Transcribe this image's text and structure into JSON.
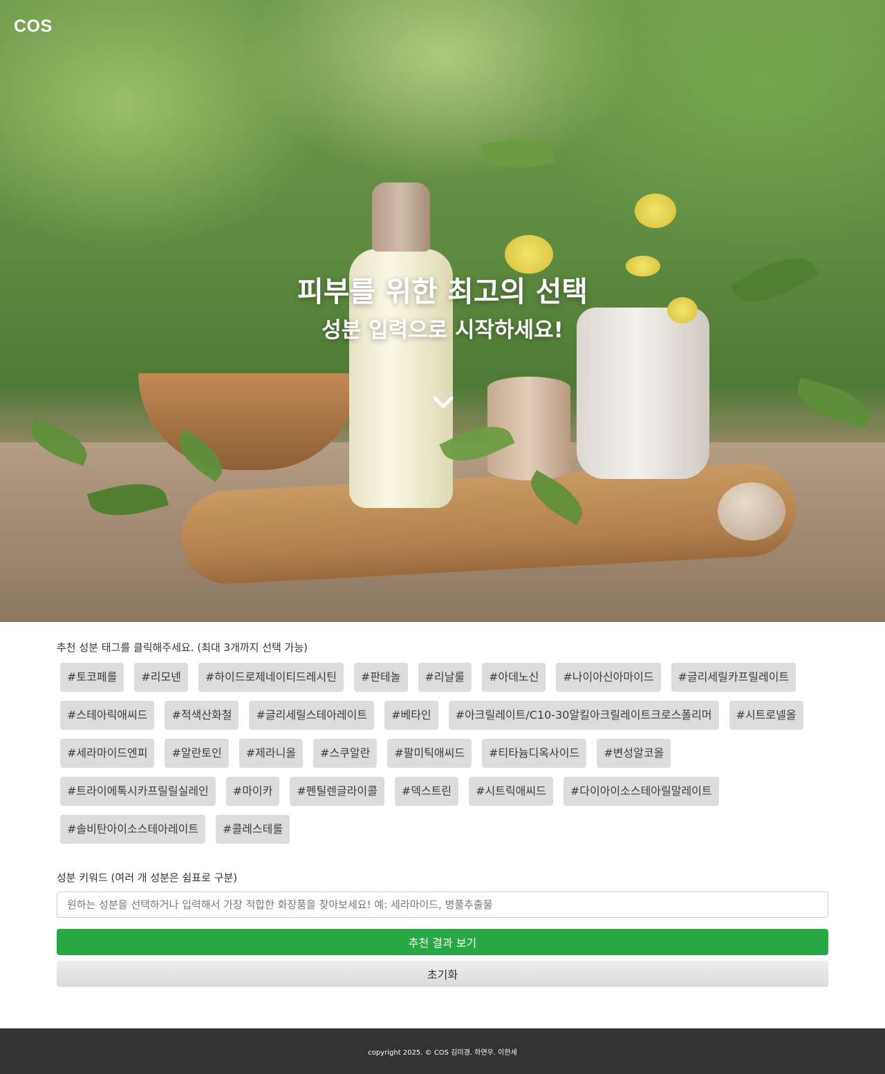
{
  "header": {
    "logo": "COS"
  },
  "hero": {
    "title": "피부를 위한 최고의 선택",
    "subtitle": "성분 입력으로 시작하세요!",
    "scroll_icon": "chevron-down-icon"
  },
  "tags_section": {
    "label": "추천 성분 태그를 클릭해주세요. (최대 3개까지 선택 가능)",
    "tags": [
      "#토코페롤",
      "#리모넨",
      "#하이드로제네이티드레시틴",
      "#판테놀",
      "#리날룰",
      "#아데노신",
      "#나이아신아마이드",
      "#글리세릴카프릴레이트",
      "#스테아릭애씨드",
      "#적색산화철",
      "#글리세릴스테아레이트",
      "#베타인",
      "#아크릴레이트/C10-30알킬아크릴레이트크로스폴리머",
      "#시트로넬올",
      "#세라마이드엔피",
      "#알란토인",
      "#제라니올",
      "#스쿠알란",
      "#팔미틱애씨드",
      "#티타늄디옥사이드",
      "#변성알코올",
      "#트라이에톡시카프릴릴실레인",
      "#마이카",
      "#펜틸렌글라이콜",
      "#덱스트린",
      "#시트릭애씨드",
      "#다이아이소스테아릴말레이트",
      "#솔비탄아이소스테아레이트",
      "#콜레스테롤"
    ]
  },
  "keyword": {
    "label": "성분 키워드 (여러 개 성분은 쉼표로 구분)",
    "placeholder": "원하는 성분을 선택하거나 입력해서 가장 적합한 화장품을 찾아보세요! 예: 세라마이드, 병풀추출물",
    "value": ""
  },
  "buttons": {
    "submit": "추천 결과 보기",
    "reset": "초기화"
  },
  "footer": {
    "copyright": "copyright 2025. © COS 김미경. 하연우. 이한세"
  },
  "colors": {
    "primary_green": "#28a745",
    "tag_bg": "#dcdcdc",
    "footer_bg": "#333333"
  }
}
